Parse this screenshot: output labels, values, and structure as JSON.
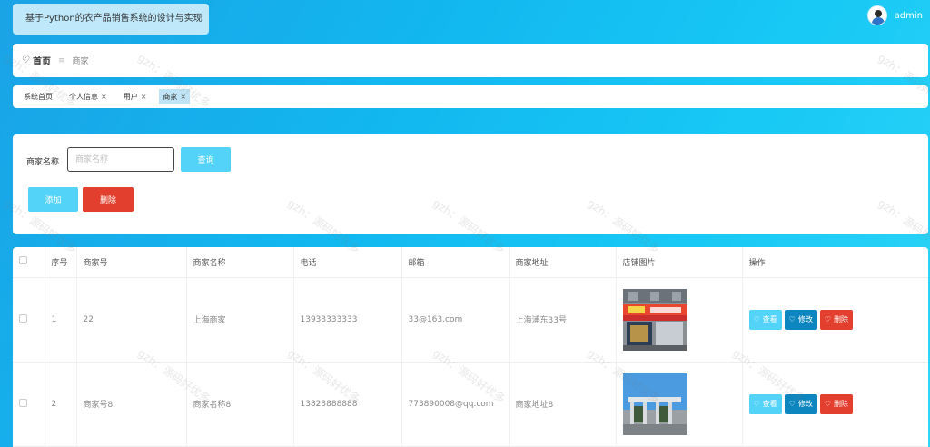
{
  "header": {
    "title": "基于Python的农产品销售系统的设计与实现",
    "username": "admin"
  },
  "breadcrumb": {
    "home": "首页",
    "separator": "≡",
    "current": "商家"
  },
  "tags": [
    {
      "label": "系统首页",
      "closable": false,
      "active": false
    },
    {
      "label": "个人信息",
      "closable": true,
      "active": false
    },
    {
      "label": "用户",
      "closable": true,
      "active": false
    },
    {
      "label": "商家",
      "closable": true,
      "active": true
    }
  ],
  "close_glyph": "×",
  "search": {
    "label": "商家名称",
    "placeholder": "商家名称",
    "query_button": "查询",
    "add_button": "添加",
    "delete_button": "删除"
  },
  "table": {
    "columns": [
      "序号",
      "商家号",
      "商家名称",
      "电话",
      "邮箱",
      "商家地址",
      "店铺图片",
      "操作"
    ],
    "rows": [
      {
        "index": "1",
        "shop_no": "22",
        "name": "上海商家",
        "phone": "13933333333",
        "email": "33@163.com",
        "address": "上海浦东33号"
      },
      {
        "index": "2",
        "shop_no": "商家号8",
        "name": "商家名称8",
        "phone": "13823888888",
        "email": "773890008@qq.com",
        "address": "商家地址8"
      }
    ],
    "actions": {
      "view": "查看",
      "edit": "修改",
      "delete": "删除"
    }
  },
  "watermark": "gzh：源码好优多",
  "colors": {
    "accent": "#53d3f7",
    "edit": "#0d86bf",
    "danger": "#e33f2e"
  }
}
